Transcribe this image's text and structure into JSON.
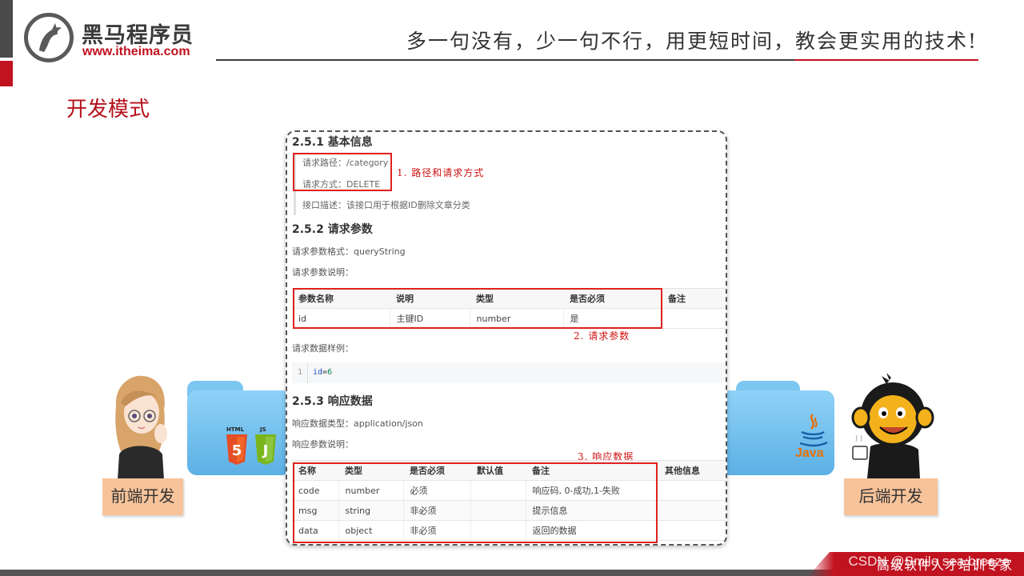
{
  "header": {
    "brand_name": "黑马程序员",
    "brand_url": "www.itheima.com",
    "slogan": "多一句没有，少一句不行，用更短时间，教会更实用的技术!"
  },
  "section_title": "开发模式",
  "roles": {
    "frontend": "前端开发",
    "backend": "后端开发"
  },
  "tech_icons": {
    "html_label": "HTML",
    "js_label": "JS",
    "java_label": "Java"
  },
  "doc": {
    "s1_title": "2.5.1 基本信息",
    "path_line": "请求路径：/category",
    "method_line": "请求方式：DELETE",
    "desc_line": "接口描述：该接口用于根据ID删除文章分类",
    "annot1": "1. 路径和请求方式",
    "s2_title": "2.5.2 请求参数",
    "param_format": "请求参数格式：queryString",
    "param_desc": "请求参数说明：",
    "param_table": {
      "headers": [
        "参数名称",
        "说明",
        "类型",
        "是否必须",
        "备注"
      ],
      "rows": [
        [
          "id",
          "主键ID",
          "number",
          "是",
          ""
        ]
      ]
    },
    "annot2": "2. 请求参数",
    "sample_label": "请求数据样例：",
    "code_line_no": "1",
    "code_key": "id",
    "code_eq": "=",
    "code_val": "6",
    "s3_title": "2.5.3 响应数据",
    "resp_type": "响应数据类型：application/json",
    "resp_desc": "响应参数说明：",
    "annot3": "3. 响应数据",
    "resp_table": {
      "headers": [
        "名称",
        "类型",
        "是否必须",
        "默认值",
        "备注",
        "其他信息"
      ],
      "rows": [
        [
          "code",
          "number",
          "必须",
          "",
          "响应码, 0-成功,1-失败",
          ""
        ],
        [
          "msg",
          "string",
          "非必须",
          "",
          "提示信息",
          ""
        ],
        [
          "data",
          "object",
          "非必须",
          "",
          "返回的数据",
          ""
        ]
      ]
    }
  },
  "footer": {
    "text": "高级软件人才培训专家",
    "watermark": "CSDN @Smile sea breeze"
  },
  "colors": {
    "brand_red": "#c1121f",
    "annot_red": "#d01010",
    "role_label_bg": "#f7c39a",
    "folder_blue": "#7cc6f2"
  }
}
